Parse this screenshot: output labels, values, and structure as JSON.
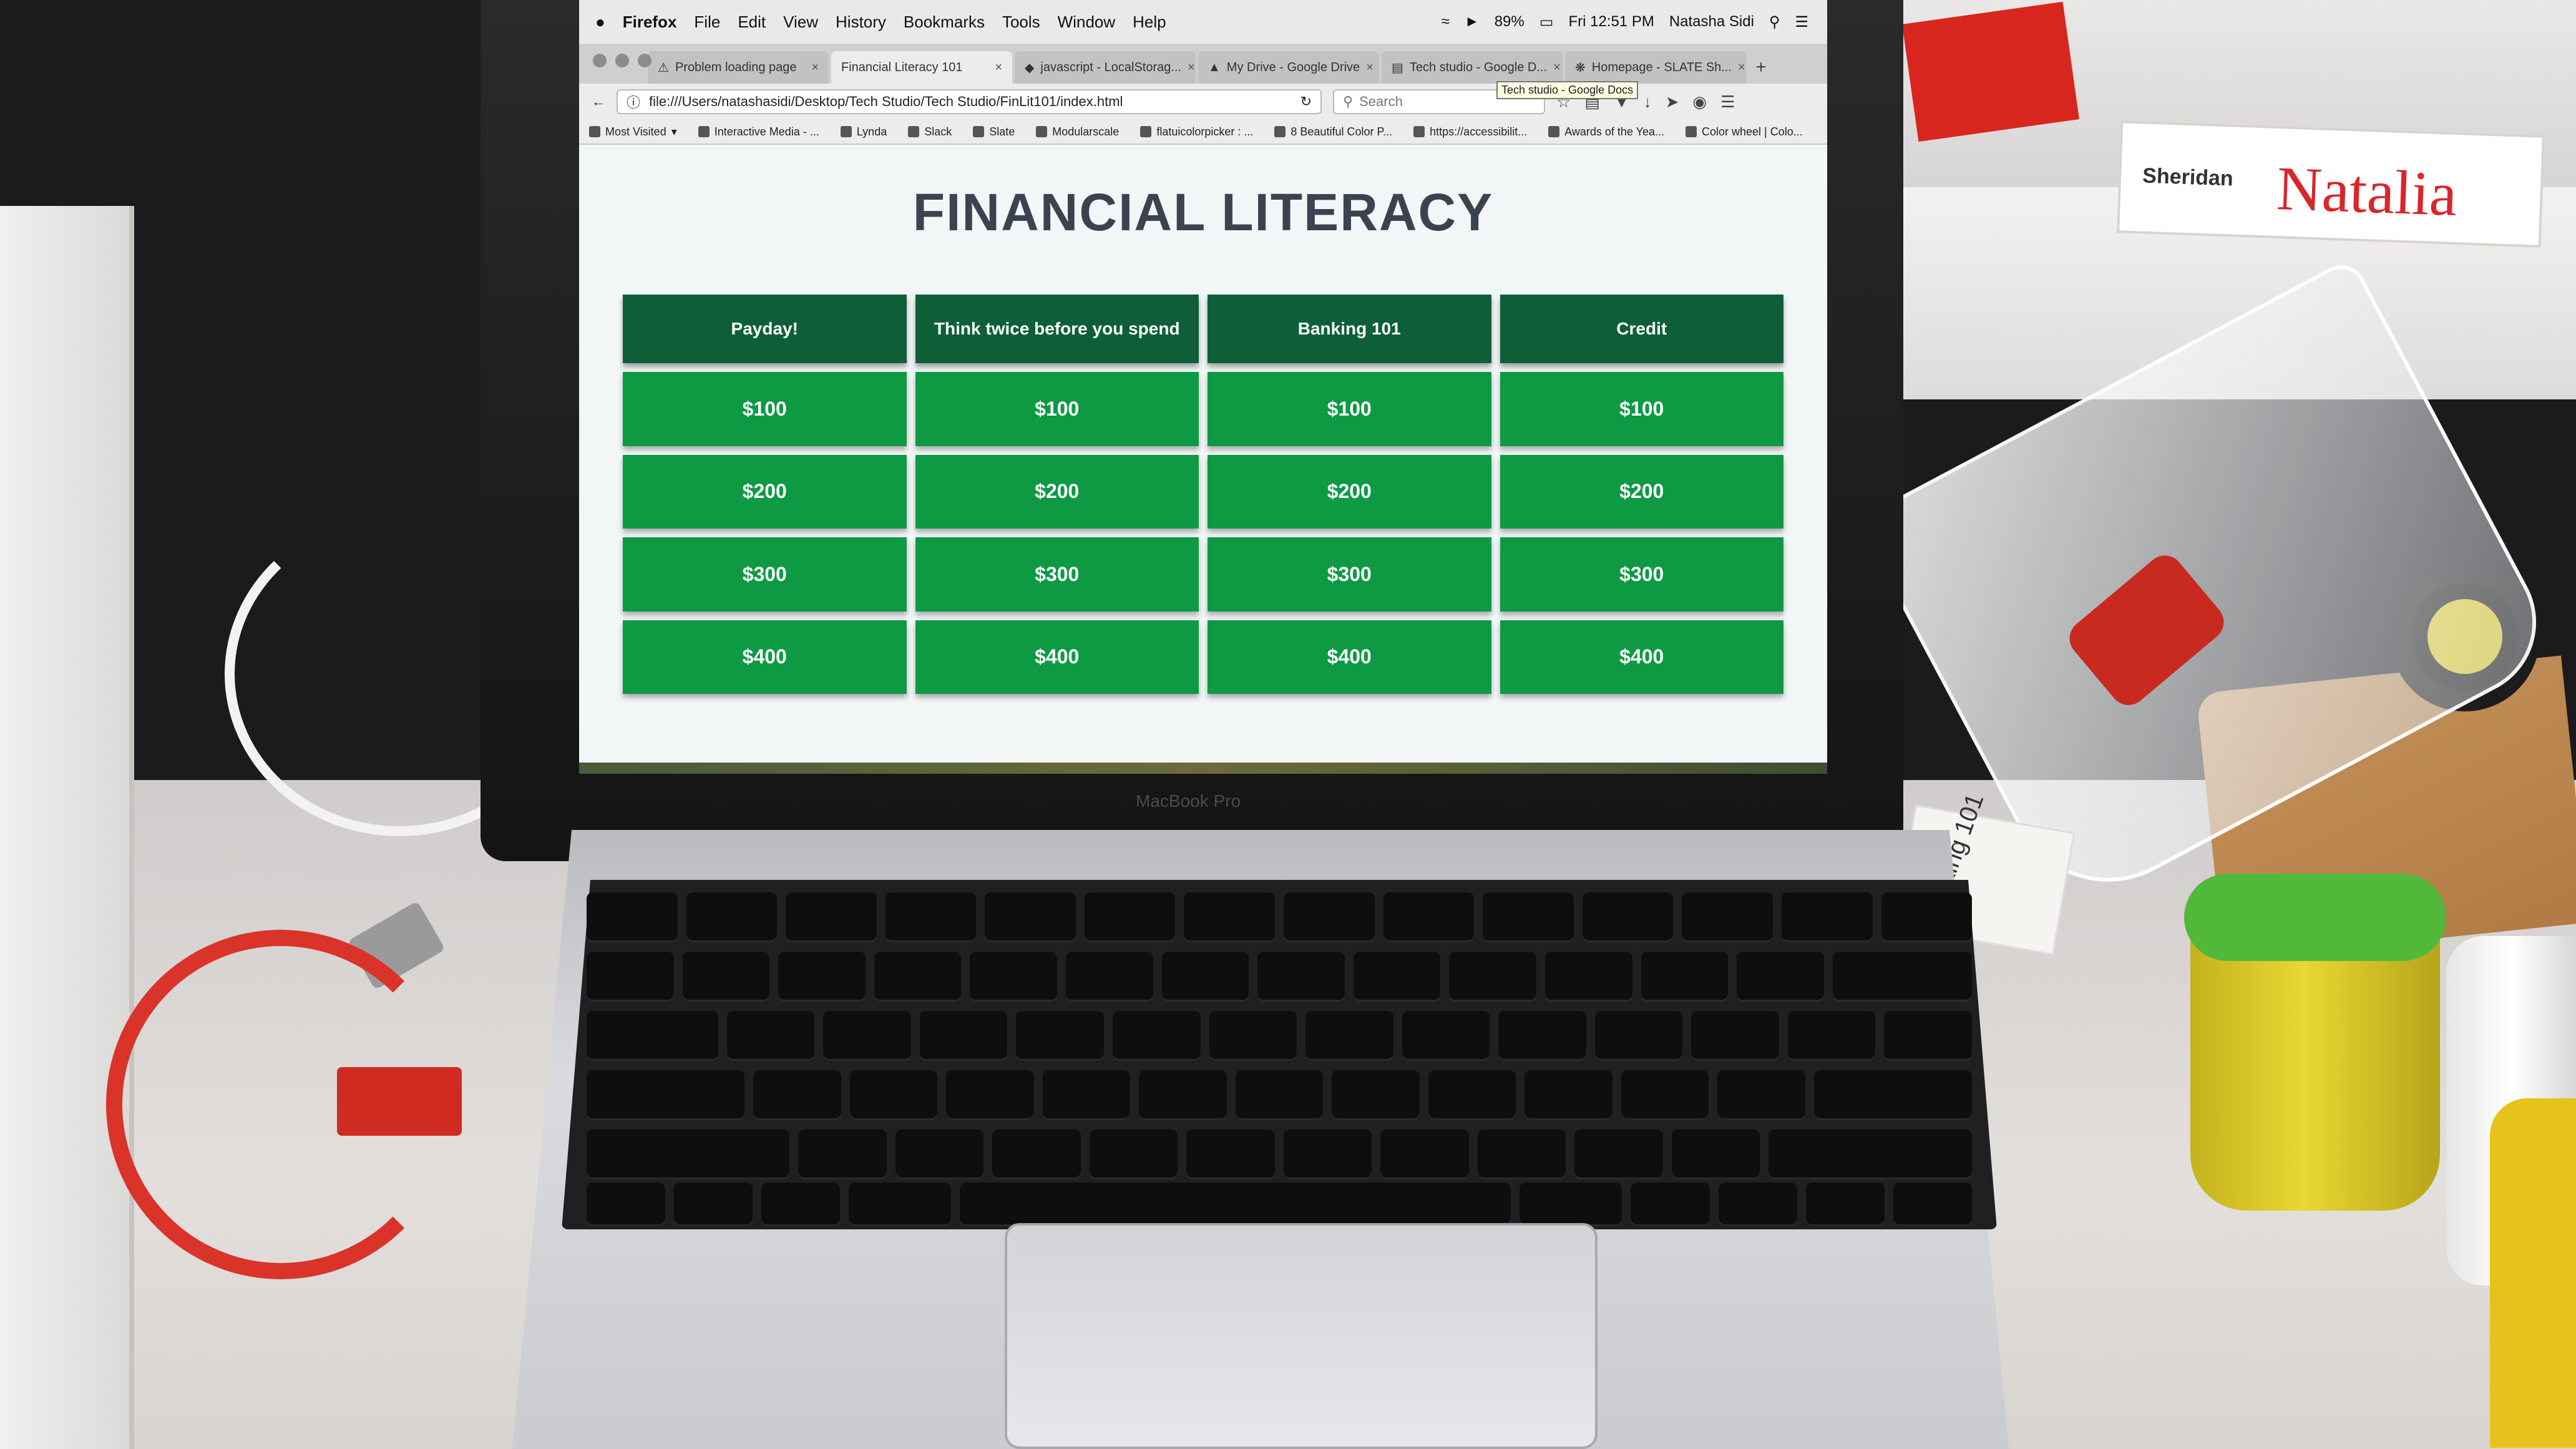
{
  "menubar": {
    "app": "Firefox",
    "menus": [
      "File",
      "Edit",
      "View",
      "History",
      "Bookmarks",
      "Tools",
      "Window",
      "Help"
    ],
    "battery": "89%",
    "clock": "Fri 12:51 PM",
    "user": "Natasha Sidi"
  },
  "tabs": [
    {
      "label": "Problem loading page"
    },
    {
      "label": "Financial Literacy 101"
    },
    {
      "label": "javascript - LocalStorag..."
    },
    {
      "label": "My Drive - Google Drive"
    },
    {
      "label": "Tech studio - Google D..."
    },
    {
      "label": "Homepage - SLATE Sh..."
    }
  ],
  "tooltip": "Tech studio - Google Docs",
  "navbar": {
    "url": "file:///Users/natashasidi/Desktop/Tech Studio/Tech Studio/FinLit101/index.html",
    "search_placeholder": "Search"
  },
  "bookmarks": [
    "Most Visited",
    "Interactive Media - ...",
    "Lynda",
    "Slack",
    "Slate",
    "Modularscale",
    "flatuicolorpicker : ...",
    "8 Beautiful Color P...",
    "https://accessibilit...",
    "Awards of the Yea...",
    "Color wheel | Colo..."
  ],
  "page": {
    "title": "FINANCIAL LITERACY",
    "categories": [
      "Payday!",
      "Think twice before you spend",
      "Banking 101",
      "Credit"
    ],
    "values": [
      [
        "$100",
        "$100",
        "$100",
        "$100"
      ],
      [
        "$200",
        "$200",
        "$200",
        "$200"
      ],
      [
        "$300",
        "$300",
        "$300",
        "$300"
      ],
      [
        "$400",
        "$400",
        "$400",
        "$400"
      ]
    ]
  },
  "scene": {
    "laptop_label": "MacBook Pro",
    "nametag_logo": "Sheridan",
    "nametag_name": "Natalia",
    "card_text": "Banking 101"
  }
}
